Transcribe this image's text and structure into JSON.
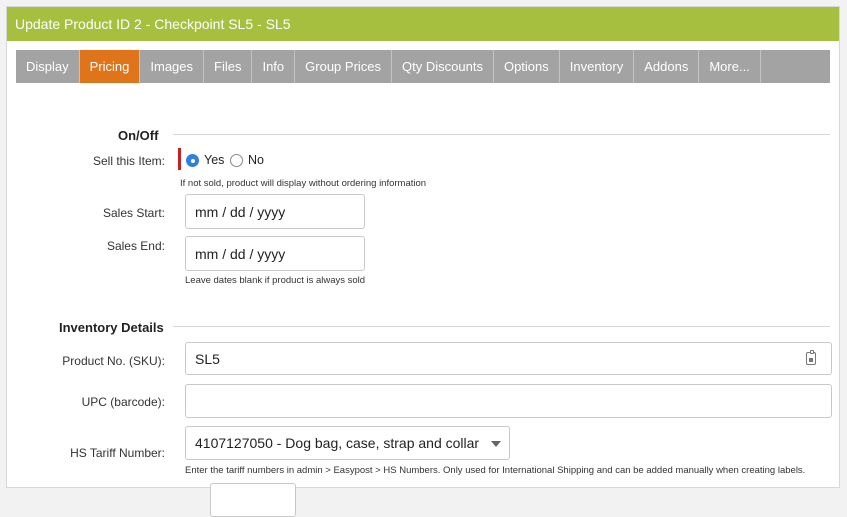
{
  "header": {
    "title": "Update Product ID 2 - Checkpoint SL5 - SL5"
  },
  "tabs": [
    {
      "label": "Display"
    },
    {
      "label": "Pricing"
    },
    {
      "label": "Images"
    },
    {
      "label": "Files"
    },
    {
      "label": "Info"
    },
    {
      "label": "Group Prices"
    },
    {
      "label": "Qty Discounts"
    },
    {
      "label": "Options"
    },
    {
      "label": "Inventory"
    },
    {
      "label": "Addons"
    },
    {
      "label": "More..."
    }
  ],
  "active_tab": "Pricing",
  "onoff": {
    "title": "On/Off",
    "sell_label": "Sell this Item:",
    "yes_label": "Yes",
    "no_label": "No",
    "sell_value": "Yes",
    "sell_help": "If not sold, product will display without ordering information",
    "start_label": "Sales Start:",
    "start_placeholder": "mm / dd / yyyy",
    "end_label": "Sales End:",
    "end_placeholder": "mm / dd / yyyy",
    "dates_help": "Leave dates blank if product is always sold"
  },
  "inventory": {
    "title": "Inventory Details",
    "sku_label": "Product No. (SKU):",
    "sku_value": "SL5",
    "upc_label": "UPC (barcode):",
    "upc_value": "",
    "hs_label": "HS Tariff Number:",
    "hs_value": "4107127050 - Dog bag, case, strap and collar",
    "hs_help": "Enter the tariff numbers in admin > Easypost > HS Numbers. Only used for International Shipping and can be added manually when creating labels."
  },
  "colors": {
    "header": "#a7bf3f",
    "tabbar": "#a3a3a3",
    "active_tab": "#e0741a",
    "radio_selected": "#2f7fe0",
    "required_marker": "#c62020"
  }
}
